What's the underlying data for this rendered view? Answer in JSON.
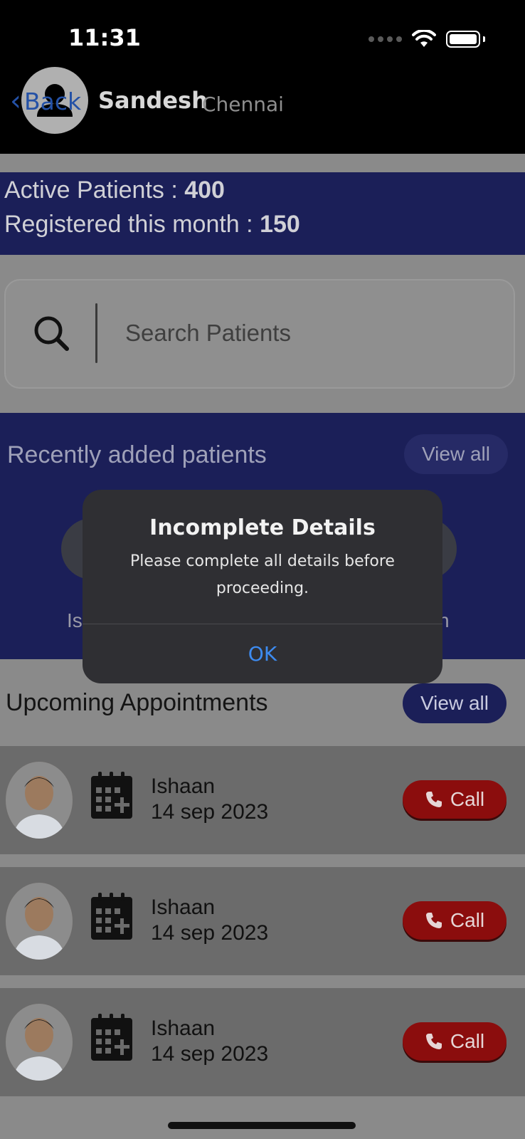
{
  "status_bar": {
    "time": "11:31"
  },
  "header": {
    "back_label": "Back",
    "user_name": "Sandesh",
    "user_city": "Chennai"
  },
  "stats": {
    "active_label": "Active Patients : ",
    "active_value": "400",
    "registered_label": "Registered this month : ",
    "registered_value": "150"
  },
  "search": {
    "placeholder": "Search Patients"
  },
  "recent": {
    "title": "Recently added patients",
    "view_all_label": "View all",
    "visible_name_fragments": [
      "Is",
      "n"
    ]
  },
  "upcoming": {
    "title": "Upcoming Appointments",
    "view_all_label": "View all",
    "appointments": [
      {
        "name": "Ishaan",
        "date": "14 sep 2023",
        "call_label": "Call"
      },
      {
        "name": "Ishaan",
        "date": "14 sep 2023",
        "call_label": "Call"
      },
      {
        "name": "Ishaan",
        "date": "14 sep 2023",
        "call_label": "Call"
      }
    ]
  },
  "alert": {
    "title": "Incomplete Details",
    "message": "Please complete all details before proceeding.",
    "ok_label": "OK"
  },
  "colors": {
    "primary": "#1b1f58",
    "call_red": "#8b0d0d",
    "ios_blue": "#3d8bf0"
  }
}
